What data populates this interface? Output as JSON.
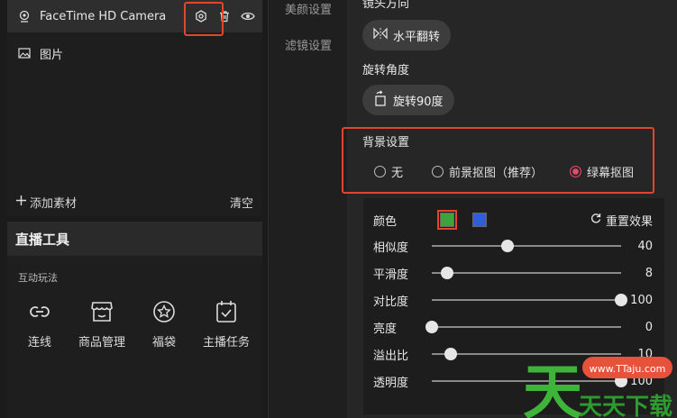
{
  "sources": {
    "camera_label": "FaceTime HD Camera",
    "image_label": "图片",
    "add_material": "添加素材",
    "clear": "清空"
  },
  "live_tools": {
    "title": "直播工具",
    "subtitle": "互动玩法",
    "items": [
      {
        "label": "连线",
        "icon": "link-icon"
      },
      {
        "label": "商品管理",
        "icon": "store-icon"
      },
      {
        "label": "福袋",
        "icon": "star-badge-icon"
      },
      {
        "label": "主播任务",
        "icon": "calendar-check-icon"
      }
    ]
  },
  "nav": {
    "beauty": "美颜设置",
    "filter": "滤镜设置"
  },
  "settings": {
    "mirror_label": "镜头方向",
    "mirror_button": "水平翻转",
    "rotate_label": "旋转角度",
    "rotate_button": "旋转90度",
    "background_label": "背景设置",
    "bg_options": [
      "无",
      "前景抠图（推荐）",
      "绿幕抠图"
    ],
    "bg_selected": "绿幕抠图"
  },
  "greenscreen": {
    "color_label": "颜色",
    "colors": [
      "#3fa33b",
      "#2f5ed6"
    ],
    "selected_color": "#3fa33b",
    "reset_label": "重置效果",
    "sliders": [
      {
        "label": "相似度",
        "value": 40
      },
      {
        "label": "平滑度",
        "value": 8
      },
      {
        "label": "对比度",
        "value": 100
      },
      {
        "label": "亮度",
        "value": 0
      },
      {
        "label": "溢出比",
        "value": 10
      },
      {
        "label": "透明度",
        "value": 100
      }
    ]
  },
  "watermark": {
    "url": "www.TTaju.com",
    "brand": "天天下载"
  },
  "colors": {
    "highlight": "#e2452d",
    "radio_active": "#e84b6b"
  }
}
